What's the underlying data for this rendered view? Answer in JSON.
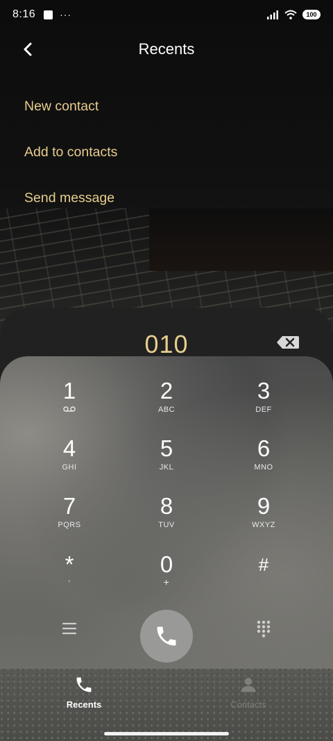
{
  "status_bar": {
    "time": "8:16",
    "dots": "···",
    "battery": "100"
  },
  "header": {
    "title": "Recents"
  },
  "menu": [
    {
      "label": "New contact"
    },
    {
      "label": "Add to contacts"
    },
    {
      "label": "Send message"
    }
  ],
  "dialer": {
    "number": "010",
    "keys": [
      {
        "digit": "1",
        "letters": ""
      },
      {
        "digit": "2",
        "letters": "ABC"
      },
      {
        "digit": "3",
        "letters": "DEF"
      },
      {
        "digit": "4",
        "letters": "GHI"
      },
      {
        "digit": "5",
        "letters": "JKL"
      },
      {
        "digit": "6",
        "letters": "MNO"
      },
      {
        "digit": "7",
        "letters": "PQRS"
      },
      {
        "digit": "8",
        "letters": "TUV"
      },
      {
        "digit": "9",
        "letters": "WXYZ"
      },
      {
        "digit": "*",
        "letters": ","
      },
      {
        "digit": "0",
        "letters": "+"
      },
      {
        "digit": "#",
        "letters": ""
      }
    ]
  },
  "bottom_nav": {
    "tabs": [
      {
        "label": "Recents",
        "icon": "phone-icon",
        "active": true
      },
      {
        "label": "Contacts",
        "icon": "person-icon",
        "active": false
      }
    ]
  },
  "colors": {
    "accent": "#e8cd8e",
    "call_button": "#999997"
  }
}
